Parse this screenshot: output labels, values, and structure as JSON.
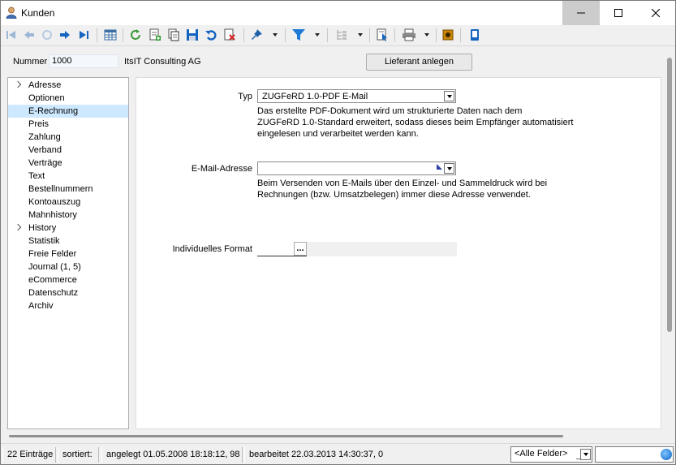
{
  "window": {
    "title": "Kunden"
  },
  "header": {
    "nummer_label": "Nummer",
    "nummer_value": "1000",
    "company": "ItsIT Consulting AG",
    "lieferant_button": "Lieferant anlegen"
  },
  "nav": {
    "items": [
      {
        "label": "Adresse",
        "expandable": true
      },
      {
        "label": "Optionen"
      },
      {
        "label": "E-Rechnung",
        "selected": true
      },
      {
        "label": "Preis"
      },
      {
        "label": "Zahlung"
      },
      {
        "label": "Verband"
      },
      {
        "label": "Verträge"
      },
      {
        "label": "Text"
      },
      {
        "label": "Bestellnummern"
      },
      {
        "label": "Kontoauszug"
      },
      {
        "label": "Mahnhistory"
      },
      {
        "label": "History",
        "expandable": true
      },
      {
        "label": "Statistik"
      },
      {
        "label": "Freie Felder"
      },
      {
        "label": "Journal (1, 5)"
      },
      {
        "label": "eCommerce"
      },
      {
        "label": "Datenschutz"
      },
      {
        "label": "Archiv"
      }
    ]
  },
  "form": {
    "typ_label": "Typ",
    "typ_value": "ZUGFeRD 1.0-PDF E-Mail",
    "typ_help_1": "Das erstellte PDF-Dokument wird um strukturierte Daten nach dem",
    "typ_help_2": "ZUGFeRD 1.0-Standard erweitert, sodass dieses beim Empfänger automatisiert",
    "typ_help_3": "eingelesen und verarbeitet werden kann.",
    "email_label": "E-Mail-Adresse",
    "email_value": "",
    "email_help_1": "Beim Versenden von E-Mails über den Einzel- und Sammeldruck wird bei",
    "email_help_2": "Rechnungen (bzw. Umsatzbelegen) immer diese Adresse verwendet.",
    "format_label": "Individuelles Format",
    "format_value": "",
    "format_button": "..."
  },
  "status": {
    "count": "22 Einträge",
    "sorted": "sortiert:",
    "created": "angelegt 01.05.2008 18:18:12, 98",
    "edited": "bearbeitet 22.03.2013 14:30:37,  0",
    "filter": "<Alle Felder>",
    "search_value": ""
  },
  "colors": {
    "selection": "#cde8ff",
    "accent_blue": "#1565c0",
    "filter_blue": "#1e7ad6"
  }
}
